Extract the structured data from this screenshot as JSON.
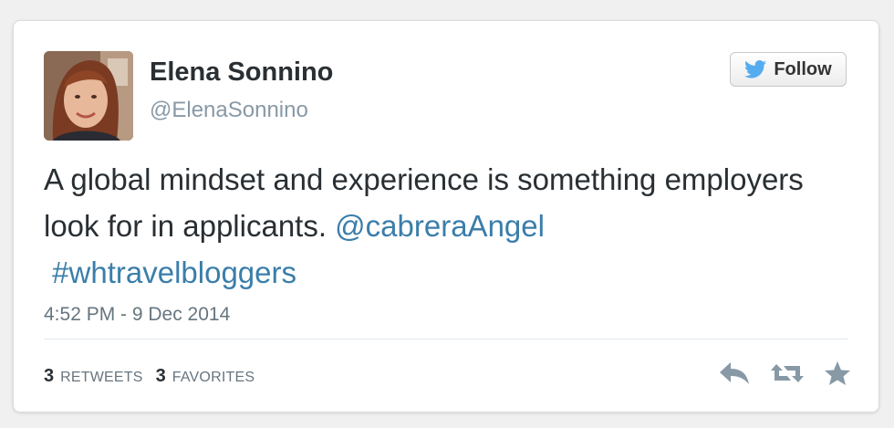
{
  "author": {
    "display_name": "Elena Sonnino",
    "handle": "@ElenaSonnino"
  },
  "follow_button": {
    "label": "Follow",
    "icon": "twitter-bird-icon"
  },
  "tweet": {
    "text_part1": "A global mindset and experience is something employers look for in applicants. ",
    "mention": "@cabreraAngel",
    "hashtag": "#whtravelbloggers",
    "timestamp": "4:52 PM - 9 Dec 2014"
  },
  "stats": {
    "retweets_count": "3",
    "retweets_label": "RETWEETS",
    "favorites_count": "3",
    "favorites_label": "FAVORITES"
  },
  "actions": {
    "icons": [
      "reply-icon",
      "retweet-icon",
      "favorite-star-icon"
    ]
  },
  "colors": {
    "link": "#3b7eaa",
    "text": "#292f33",
    "muted": "#66757f",
    "twitter_blue": "#55acee"
  }
}
